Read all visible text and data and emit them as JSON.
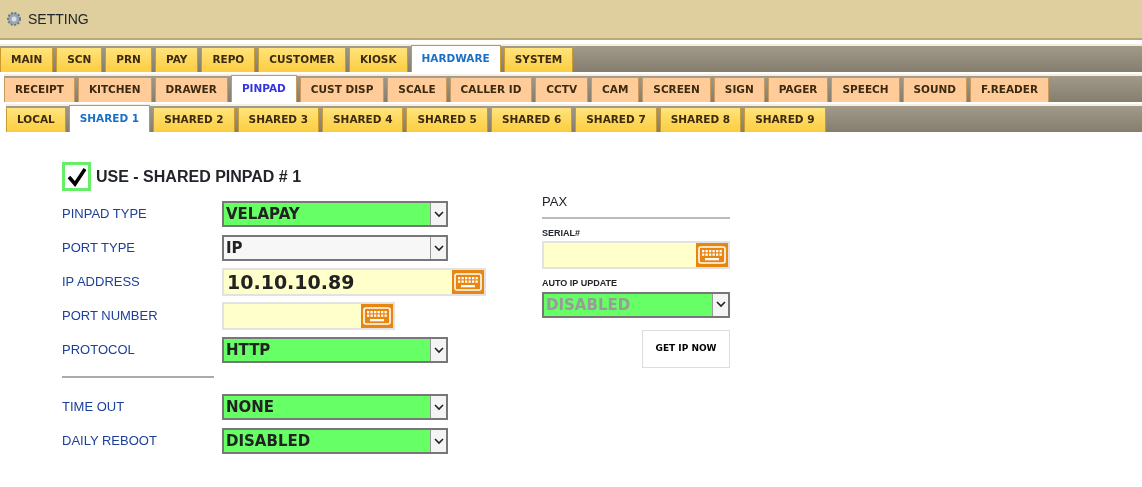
{
  "window": {
    "title": "SETTING"
  },
  "main_tabs": [
    {
      "label": "MAIN",
      "selected": false
    },
    {
      "label": "SCN",
      "selected": false
    },
    {
      "label": "PRN",
      "selected": false
    },
    {
      "label": "PAY",
      "selected": false
    },
    {
      "label": "REPO",
      "selected": false
    },
    {
      "label": "CUSTOMER",
      "selected": false
    },
    {
      "label": "KIOSK",
      "selected": false
    },
    {
      "label": "HARDWARE",
      "selected": true
    },
    {
      "label": "SYSTEM",
      "selected": false
    }
  ],
  "hardware_tabs": [
    {
      "label": "RECEIPT",
      "selected": false
    },
    {
      "label": "KITCHEN",
      "selected": false
    },
    {
      "label": "DRAWER",
      "selected": false
    },
    {
      "label": "PINPAD",
      "selected": true
    },
    {
      "label": "CUST DISP",
      "selected": false
    },
    {
      "label": "SCALE",
      "selected": false
    },
    {
      "label": "CALLER ID",
      "selected": false
    },
    {
      "label": "CCTV",
      "selected": false
    },
    {
      "label": "CAM",
      "selected": false
    },
    {
      "label": "SCREEN",
      "selected": false
    },
    {
      "label": "SIGN",
      "selected": false
    },
    {
      "label": "PAGER",
      "selected": false
    },
    {
      "label": "SPEECH",
      "selected": false
    },
    {
      "label": "SOUND",
      "selected": false
    },
    {
      "label": "F.READER",
      "selected": false
    }
  ],
  "pinpad_tabs": [
    {
      "label": "LOCAL",
      "selected": false
    },
    {
      "label": "SHARED 1",
      "selected": true
    },
    {
      "label": "SHARED 2",
      "selected": false
    },
    {
      "label": "SHARED 3",
      "selected": false
    },
    {
      "label": "SHARED 4",
      "selected": false
    },
    {
      "label": "SHARED 5",
      "selected": false
    },
    {
      "label": "SHARED 6",
      "selected": false
    },
    {
      "label": "SHARED 7",
      "selected": false
    },
    {
      "label": "SHARED 8",
      "selected": false
    },
    {
      "label": "SHARED 9",
      "selected": false
    }
  ],
  "use_checkbox": {
    "label": "USE - SHARED PINPAD # 1",
    "checked": true
  },
  "fields": [
    {
      "label": "PINPAD TYPE",
      "kind": "select",
      "value": "VELAPAY",
      "highlighted": true
    },
    {
      "label": "PORT TYPE",
      "kind": "select",
      "value": "IP",
      "highlighted": false
    },
    {
      "label": "IP ADDRESS",
      "kind": "text",
      "value": "10.10.10.89",
      "wide": true
    },
    {
      "label": "PORT NUMBER",
      "kind": "text",
      "wide": false
    },
    {
      "label": "PROTOCOL",
      "kind": "select",
      "value": "HTTP",
      "highlighted": true
    },
    {
      "kind": "divider"
    },
    {
      "label": "TIME OUT",
      "kind": "select",
      "value": "NONE",
      "highlighted": true
    },
    {
      "label": "DAILY REBOOT",
      "kind": "select",
      "value": "DISABLED",
      "highlighted": true
    }
  ],
  "pax": {
    "title": "PAX",
    "fields": [
      {
        "label": "SERIAL#",
        "kind": "text",
        "disabled": false
      },
      {
        "label": "AUTO IP UPDATE",
        "kind": "select",
        "value": "DISABLED",
        "disabled": true
      }
    ],
    "button": "GET IP NOW"
  }
}
